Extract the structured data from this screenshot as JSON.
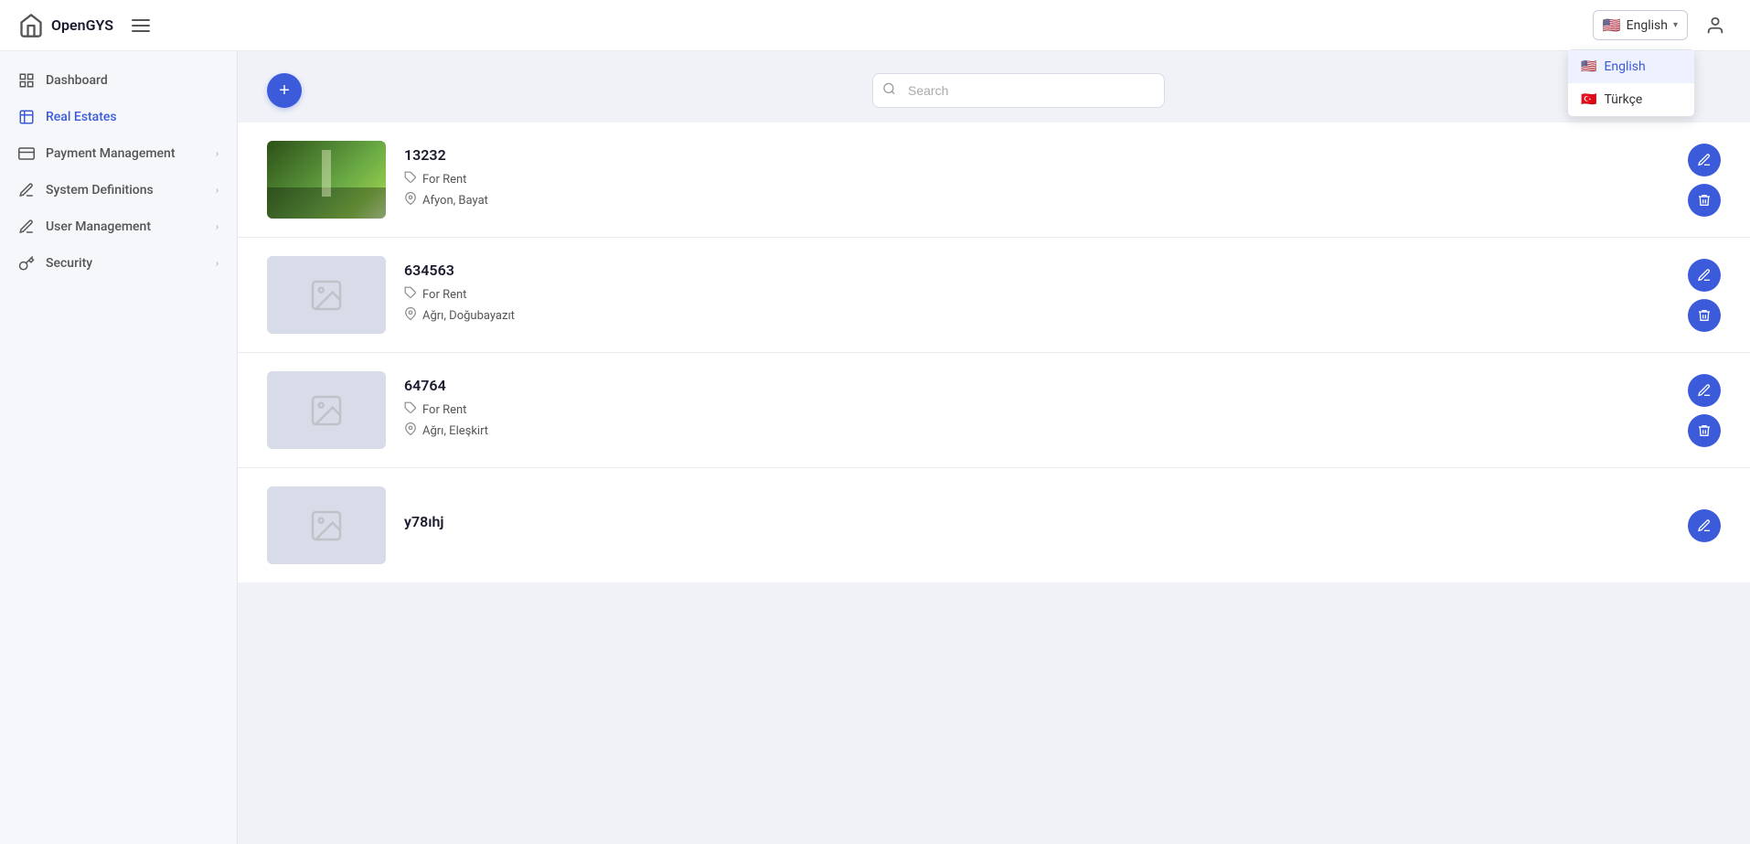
{
  "app": {
    "name": "OpenGYS",
    "logo_icon": "home"
  },
  "header": {
    "language_selector": {
      "current": "English",
      "current_flag": "🇺🇸",
      "chevron": "▾",
      "options": [
        {
          "label": "English",
          "flag": "🇺🇸",
          "active": true
        },
        {
          "label": "Türkçe",
          "flag": "🇹🇷",
          "active": false
        }
      ]
    },
    "user_icon": "user"
  },
  "sidebar": {
    "items": [
      {
        "id": "dashboard",
        "label": "Dashboard",
        "icon": "grid",
        "active": false,
        "has_arrow": false
      },
      {
        "id": "real-estates",
        "label": "Real Estates",
        "icon": "building",
        "active": true,
        "has_arrow": false
      },
      {
        "id": "payment-management",
        "label": "Payment Management",
        "icon": "credit-card",
        "active": false,
        "has_arrow": true
      },
      {
        "id": "system-definitions",
        "label": "System Definitions",
        "icon": "pen",
        "active": false,
        "has_arrow": true
      },
      {
        "id": "user-management",
        "label": "User Management",
        "icon": "pen",
        "active": false,
        "has_arrow": true
      },
      {
        "id": "security",
        "label": "Security",
        "icon": "key",
        "active": false,
        "has_arrow": true
      }
    ]
  },
  "toolbar": {
    "add_button_label": "+",
    "search_placeholder": "Search"
  },
  "properties": [
    {
      "id": "prop1",
      "title": "13232",
      "listing_type": "For Rent",
      "location": "Afyon, Bayat",
      "has_image": true,
      "image_type": "forest"
    },
    {
      "id": "prop2",
      "title": "634563",
      "listing_type": "For Rent",
      "location": "Ağrı, Doğubayazıt",
      "has_image": false,
      "image_type": "placeholder"
    },
    {
      "id": "prop3",
      "title": "64764",
      "listing_type": "For Rent",
      "location": "Ağrı, Eleşkirt",
      "has_image": false,
      "image_type": "placeholder"
    },
    {
      "id": "prop4",
      "title": "y78ıhj",
      "listing_type": "",
      "location": "",
      "has_image": false,
      "image_type": "placeholder",
      "partial": true
    }
  ],
  "actions": {
    "edit_label": "✎",
    "delete_label": "🗑"
  }
}
